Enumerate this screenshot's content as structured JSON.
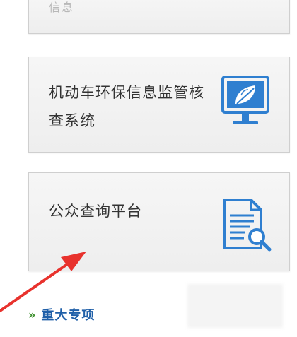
{
  "cards": {
    "top_partial": {
      "label": "信息"
    },
    "vehicle": {
      "label": "机动车环保信息监管核查系统",
      "icon": "monitor-leaf-icon",
      "icon_color": "#2f7fd0"
    },
    "public": {
      "label": "公众查询平台",
      "icon": "document-search-icon",
      "icon_color": "#2f7fd0"
    }
  },
  "section_link": {
    "chevron": "»",
    "label": "重大专项",
    "color": "#1f5fa8"
  },
  "annotation": {
    "arrow_color": "#e8322d"
  }
}
